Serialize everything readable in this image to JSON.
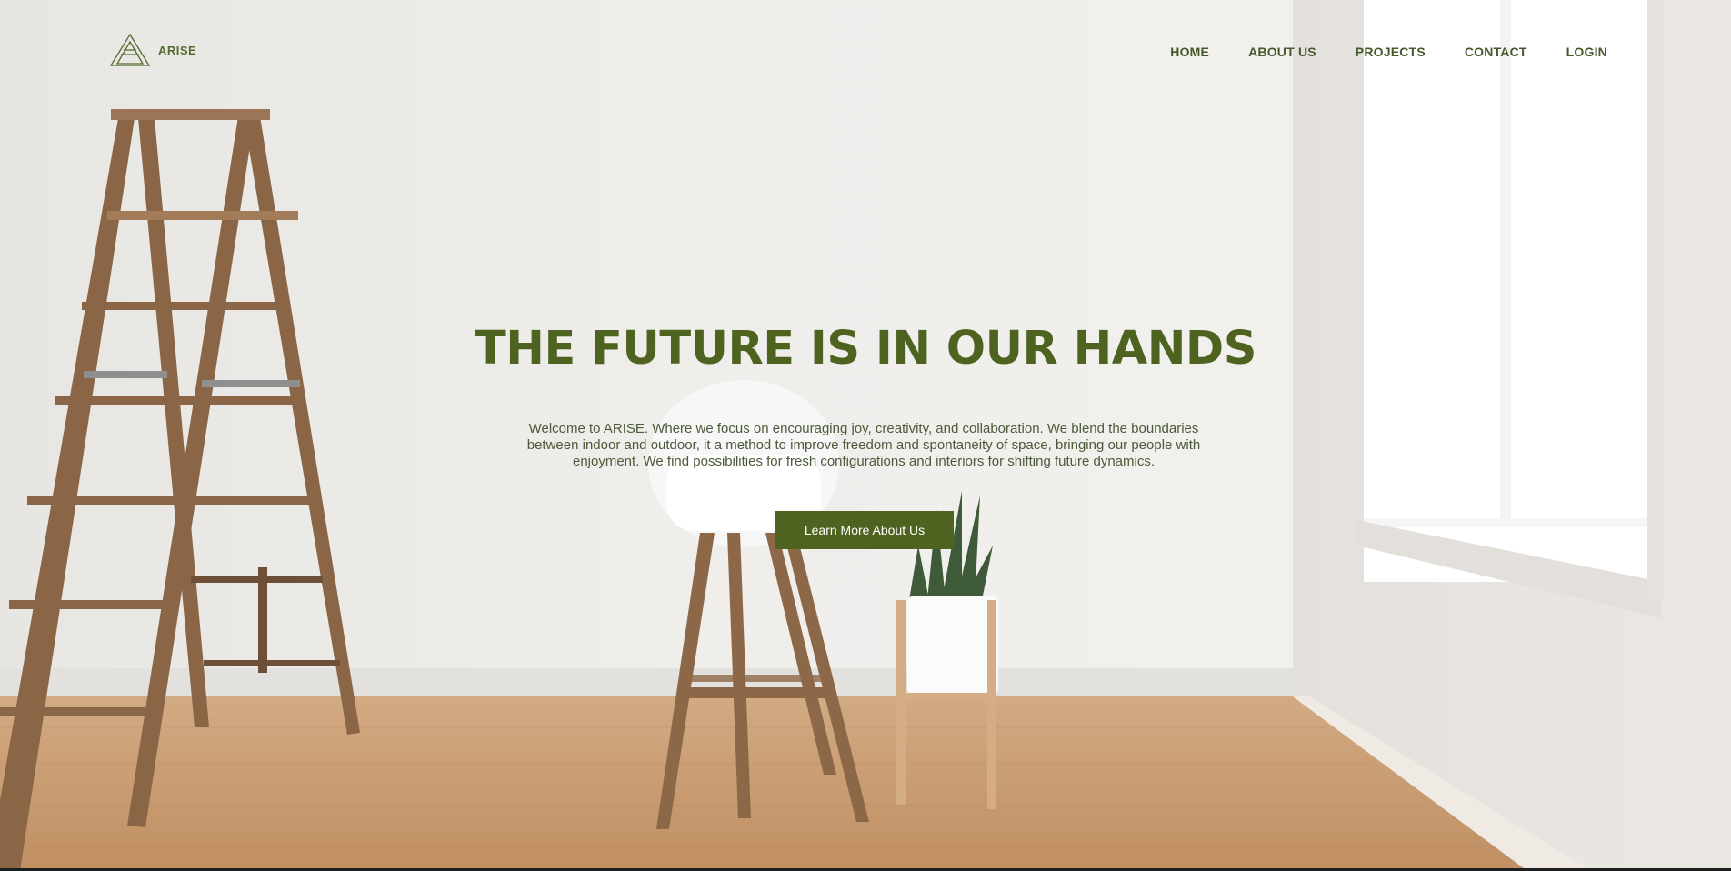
{
  "brand": {
    "name": "ARISE",
    "logo_icon": "triangle-a-logo-icon"
  },
  "nav": {
    "items": [
      {
        "label": "HOME"
      },
      {
        "label": "ABOUT US"
      },
      {
        "label": "PROJECTS"
      },
      {
        "label": "CONTACT"
      },
      {
        "label": "LOGIN"
      }
    ]
  },
  "hero": {
    "headline": "THE FUTURE IS IN OUR HANDS",
    "intro": "Welcome to ARISE. Where we focus on encouraging joy, creativity, and collaboration. We blend the boundaries between indoor and outdoor, it a method to improve freedom and spontaneity of space, bringing our people with enjoyment. We find possibilities for fresh configurations and interiors for shifting future dynamics.",
    "cta_label": "Learn More About Us",
    "background_image": "empty-room-with-ladder-chair-and-plant"
  },
  "colors": {
    "brand_green": "#4f6320",
    "nav_text": "#47592a",
    "wall": "#ecebe8",
    "floor": "#c79b71"
  }
}
